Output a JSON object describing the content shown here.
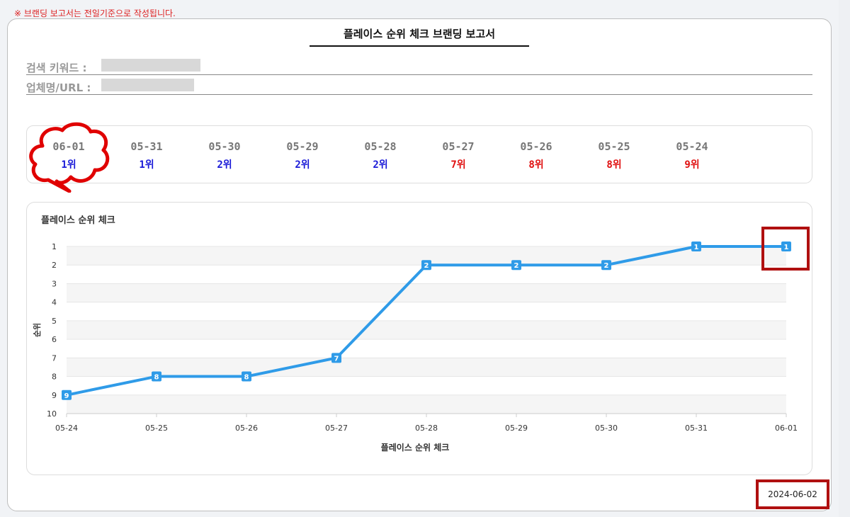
{
  "notice": "※ 브랜딩 보고서는 전일기준으로 작성됩니다.",
  "report": {
    "title": "플레이스 순위 체크 브랜딩 보고서",
    "keyword_label": "검색 키워드 :",
    "company_label": "업체명/URL :",
    "report_date": "2024-06-02"
  },
  "ranks": [
    {
      "date": "06-01",
      "rank": "1위",
      "color": "#1a1ad8"
    },
    {
      "date": "05-31",
      "rank": "1위",
      "color": "#1a1ad8"
    },
    {
      "date": "05-30",
      "rank": "2위",
      "color": "#1a1ad8"
    },
    {
      "date": "05-29",
      "rank": "2위",
      "color": "#1a1ad8"
    },
    {
      "date": "05-28",
      "rank": "2위",
      "color": "#1a1ad8"
    },
    {
      "date": "05-27",
      "rank": "7위",
      "color": "#e01010"
    },
    {
      "date": "05-26",
      "rank": "8위",
      "color": "#e01010"
    },
    {
      "date": "05-25",
      "rank": "8위",
      "color": "#e01010"
    },
    {
      "date": "05-24",
      "rank": "9위",
      "color": "#e01010"
    }
  ],
  "chart_data": {
    "type": "line",
    "title": "플레이스 순위 체크",
    "xlabel": "플레이스 순위 체크",
    "ylabel": "순위",
    "categories": [
      "05-24",
      "05-25",
      "05-26",
      "05-27",
      "05-28",
      "05-29",
      "05-30",
      "05-31",
      "06-01"
    ],
    "series": [
      {
        "values": [
          9,
          8,
          8,
          7,
          2,
          2,
          2,
          1,
          1
        ]
      }
    ],
    "ylim": [
      1,
      10
    ],
    "y_reversed": true,
    "y_ticks": [
      1,
      2,
      3,
      4,
      5,
      6,
      7,
      8,
      9,
      10
    ],
    "grid": true,
    "line_color": "#2f9be8"
  }
}
